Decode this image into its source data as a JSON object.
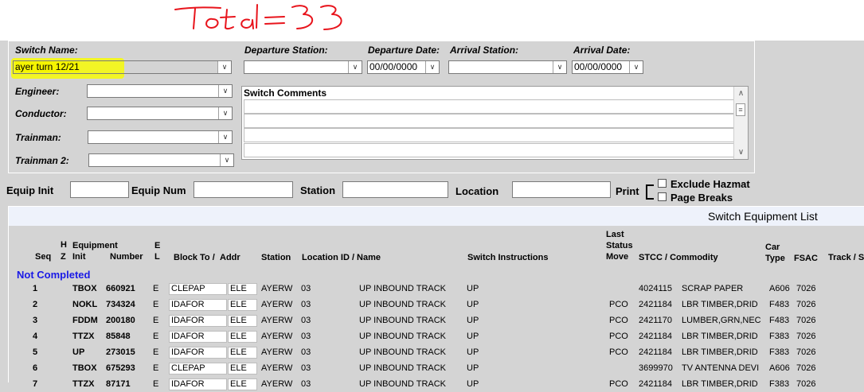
{
  "annotation": "Total=33",
  "form": {
    "switch_name_label": "Switch Name:",
    "switch_name_value": "ayer turn 12/21",
    "departure_station_label": "Departure Station:",
    "departure_station_value": "",
    "departure_date_label": "Departure Date:",
    "departure_date_value": "00/00/0000",
    "arrival_station_label": "Arrival Station:",
    "arrival_station_value": "",
    "arrival_date_label": "Arrival Date:",
    "arrival_date_value": "00/00/0000",
    "engineer_label": "Engineer:",
    "conductor_label": "Conductor:",
    "trainman_label": "Trainman:",
    "trainman2_label": "Trainman 2:",
    "switch_comments_label": "Switch Comments",
    "dropdown_glyph": "∨"
  },
  "filters": {
    "equip_init_label": "Equip Init",
    "equip_num_label": "Equip Num",
    "station_label": "Station",
    "location_label": "Location",
    "print_label": "Print",
    "exclude_hazmat_label": "Exclude Hazmat",
    "page_breaks_label": "Page Breaks"
  },
  "list": {
    "title": "Switch Equipment List",
    "group_label": "Not Completed",
    "headers": {
      "seq": "Seq",
      "hz_h": "H",
      "hz_z": "Z",
      "equipment": "Equipment",
      "init": "Init",
      "number": "Number",
      "el_e": "E",
      "el_l": "L",
      "block_to": "Block To /",
      "addr": "Addr",
      "station": "Station",
      "location": "Location ID / Name",
      "instructions": "Switch Instructions",
      "last": "Last",
      "status": "Status",
      "move": "Move",
      "stcc": "STCC / Commodity",
      "car": "Car",
      "type": "Type",
      "fsac": "FSAC",
      "track": "Track / S"
    },
    "rows": [
      {
        "seq": "1",
        "init": "TBOX",
        "number": "660921",
        "el": "E",
        "block": "CLEPAP",
        "addr": "ELE",
        "station": "AYERW",
        "loc_id": "03",
        "loc_name": "UP INBOUND TRACK",
        "instr": "UP",
        "move": "",
        "stcc": "4024115",
        "commodity": "SCRAP PAPER",
        "car_type": "A606",
        "fsac": "7026"
      },
      {
        "seq": "2",
        "init": "NOKL",
        "number": "734324",
        "el": "E",
        "block": "IDAFOR",
        "addr": "ELE",
        "station": "AYERW",
        "loc_id": "03",
        "loc_name": "UP INBOUND TRACK",
        "instr": "UP",
        "move": "PCO",
        "stcc": "2421184",
        "commodity": "LBR TIMBER,DRID",
        "car_type": "F483",
        "fsac": "7026"
      },
      {
        "seq": "3",
        "init": "FDDM",
        "number": "200180",
        "el": "E",
        "block": "IDAFOR",
        "addr": "ELE",
        "station": "AYERW",
        "loc_id": "03",
        "loc_name": "UP INBOUND TRACK",
        "instr": "UP",
        "move": "PCO",
        "stcc": "2421170",
        "commodity": "LUMBER,GRN,NEC",
        "car_type": "F483",
        "fsac": "7026"
      },
      {
        "seq": "4",
        "init": "TTZX",
        "number": "85848",
        "el": "E",
        "block": "IDAFOR",
        "addr": "ELE",
        "station": "AYERW",
        "loc_id": "03",
        "loc_name": "UP INBOUND TRACK",
        "instr": "UP",
        "move": "PCO",
        "stcc": "2421184",
        "commodity": "LBR TIMBER,DRID",
        "car_type": "F383",
        "fsac": "7026"
      },
      {
        "seq": "5",
        "init": "UP",
        "number": "273015",
        "el": "E",
        "block": "IDAFOR",
        "addr": "ELE",
        "station": "AYERW",
        "loc_id": "03",
        "loc_name": "UP INBOUND TRACK",
        "instr": "UP",
        "move": "PCO",
        "stcc": "2421184",
        "commodity": "LBR TIMBER,DRID",
        "car_type": "F383",
        "fsac": "7026"
      },
      {
        "seq": "6",
        "init": "TBOX",
        "number": "675293",
        "el": "E",
        "block": "CLEPAP",
        "addr": "ELE",
        "station": "AYERW",
        "loc_id": "03",
        "loc_name": "UP INBOUND TRACK",
        "instr": "UP",
        "move": "",
        "stcc": "3699970",
        "commodity": "TV ANTENNA DEVI",
        "car_type": "A606",
        "fsac": "7026"
      },
      {
        "seq": "7",
        "init": "TTZX",
        "number": "87171",
        "el": "E",
        "block": "IDAFOR",
        "addr": "ELE",
        "station": "AYERW",
        "loc_id": "03",
        "loc_name": "UP INBOUND TRACK",
        "instr": "UP",
        "move": "PCO",
        "stcc": "2421184",
        "commodity": "LBR TIMBER,DRID",
        "car_type": "F383",
        "fsac": "7026"
      }
    ]
  }
}
